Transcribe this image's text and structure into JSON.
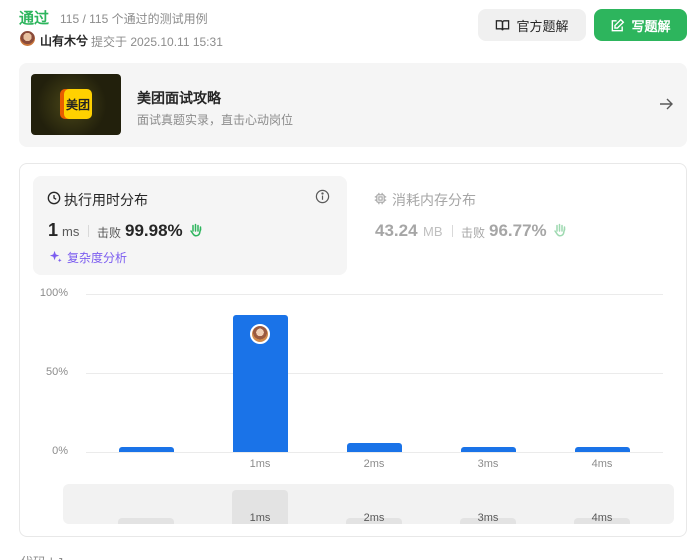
{
  "header": {
    "status": "通过",
    "testcases": "115 / 115 个通过的测试用例",
    "username": "山有木兮",
    "submitted": "提交于 2025.10.11 15:31",
    "official_solution_label": "官方题解",
    "write_solution_label": "写题解"
  },
  "promo": {
    "logo_text": "美团",
    "title": "美团面试攻略",
    "subtitle": "面试真题实录，直击心动岗位"
  },
  "runtime": {
    "title": "执行用时分布",
    "value": "1",
    "unit": "ms",
    "beats_label": "击败",
    "beats_pct": "99.98%",
    "analysis_label": "复杂度分析"
  },
  "memory": {
    "title": "消耗内存分布",
    "value": "43.24",
    "unit": "MB",
    "beats_label": "击败",
    "beats_pct": "96.77%"
  },
  "chart_data": {
    "type": "bar",
    "ytick_labels": [
      "100%",
      "50%",
      "0%"
    ],
    "ylim": [
      0,
      100
    ],
    "categories": [
      "",
      "1ms",
      "2ms",
      "3ms",
      "4ms"
    ],
    "values": [
      3,
      87,
      6,
      3,
      3
    ],
    "highlight_index": 1,
    "minimap": {
      "labels": [
        "",
        "1ms",
        "2ms",
        "3ms",
        "4ms"
      ],
      "values": [
        3,
        87,
        6,
        3,
        3
      ]
    }
  },
  "colors": {
    "accent_green": "#2db55d",
    "bar_blue": "#1a73e8",
    "analysis_purple": "#7b5cf0"
  },
  "footer": {
    "text": "代码 | Java"
  }
}
